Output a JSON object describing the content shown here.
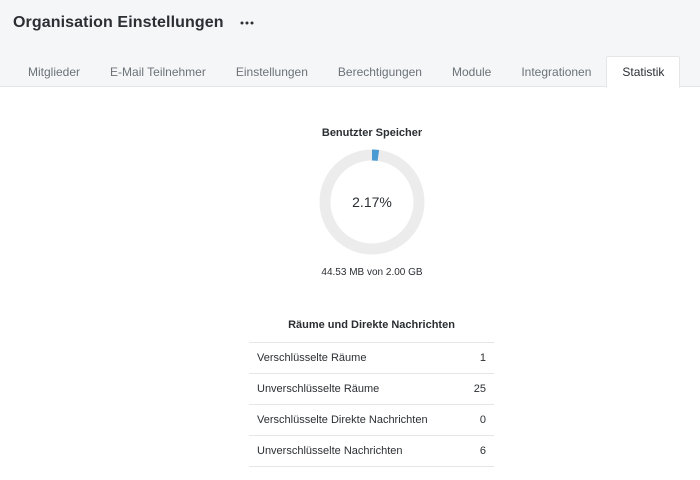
{
  "header": {
    "title": "Organisation Einstellungen",
    "more_icon": "ellipsis-horizontal-icon"
  },
  "tabs": [
    {
      "label": "Mitglieder",
      "active": false
    },
    {
      "label": "E-Mail Teilnehmer",
      "active": false
    },
    {
      "label": "Einstellungen",
      "active": false
    },
    {
      "label": "Berechtigungen",
      "active": false
    },
    {
      "label": "Module",
      "active": false
    },
    {
      "label": "Integrationen",
      "active": false
    },
    {
      "label": "Statistik",
      "active": true
    }
  ],
  "storage": {
    "title": "Benutzter Speicher",
    "percent_label": "2.17%",
    "percent_value": 2.17,
    "used_label": "44.53 MB von 2.00 GB",
    "colors": {
      "used": "#4a9ad4",
      "remaining": "#ececec"
    }
  },
  "rooms": {
    "title": "Räume und Direkte Nachrichten",
    "rows": [
      {
        "label": "Verschlüsselte Räume",
        "value": "1"
      },
      {
        "label": "Unverschlüsselte Räume",
        "value": "25"
      },
      {
        "label": "Verschlüsselte Direkte Nachrichten",
        "value": "0"
      },
      {
        "label": "Unverschlüsselte Nachrichten",
        "value": "6"
      }
    ]
  }
}
